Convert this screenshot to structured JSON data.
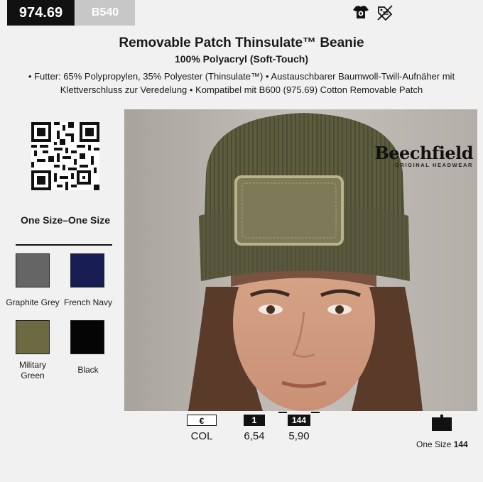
{
  "header": {
    "article_number": "974.69",
    "model_code": "B540",
    "icons": [
      "embroidery-shirt-icon",
      "no-label-icon"
    ]
  },
  "product": {
    "title": "Removable Patch Thinsulate™ Beanie",
    "material": "100% Polyacryl (Soft-Touch)",
    "description": "• Futter: 65% Polypropylen, 35% Polyester (Thinsulate™) • Austauschbarer Baumwoll-Twill-Aufnäher mit Klettverschluss zur Veredelung • Kompatibel mit B600 (975.69) Cotton Removable Patch"
  },
  "sizes": {
    "label": "One Size–One Size"
  },
  "colors": [
    {
      "name": "Graphite Grey",
      "hex": "#656565"
    },
    {
      "name": "French Navy",
      "hex": "#171c52"
    },
    {
      "name": "Military Green",
      "hex": "#6d6942"
    },
    {
      "name": "Black",
      "hex": "#050505"
    }
  ],
  "photo": {
    "brand_name": "Beechfield",
    "brand_sub": "ORIGINAL HEADWEAR"
  },
  "pricing": {
    "currency_label": "€",
    "col_label": "COL",
    "tier1_label": "1",
    "tier1_price": "6,54",
    "tier2_label": "144",
    "tier2_price": "5,90"
  },
  "packaging": {
    "size_label": "One Size",
    "quantity": "144"
  }
}
